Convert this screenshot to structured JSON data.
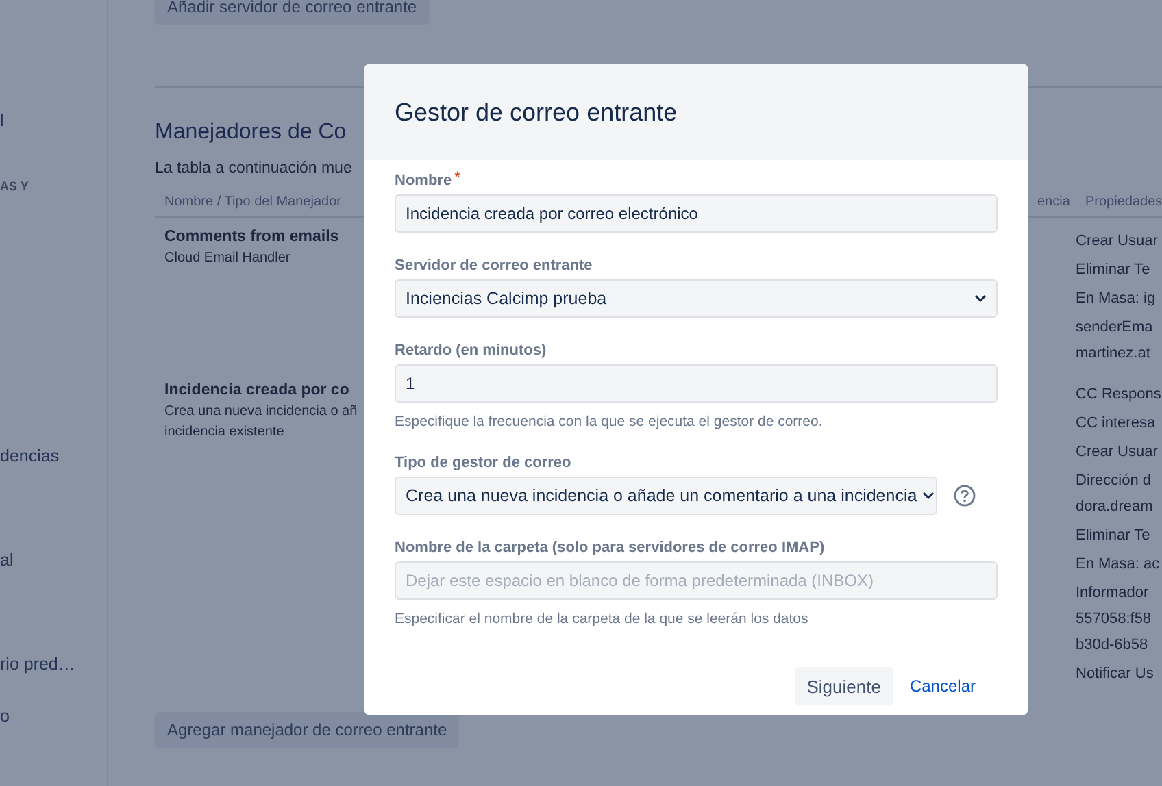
{
  "sidebar": {
    "items": [
      {
        "kind": "link",
        "label": "l"
      },
      {
        "kind": "heading",
        "label": "AS Y"
      },
      {
        "kind": "link",
        "label": "dencias"
      },
      {
        "kind": "link",
        "label": "al"
      },
      {
        "kind": "link",
        "label": "rio pred…"
      },
      {
        "kind": "link",
        "label": "o"
      }
    ]
  },
  "top_button": "Añadir servidor de correo entrante",
  "section": {
    "title": "Manejadores de Co",
    "description": "La tabla a continuación mue"
  },
  "table": {
    "columns": [
      "Nombre / Tipo del Manejador",
      "encia",
      "Propiedades"
    ],
    "rows": [
      {
        "name": "Comments from emails",
        "type": [
          "Cloud Email Handler"
        ],
        "properties": [
          [
            "Crear Usuar"
          ],
          [
            "Eliminar Te"
          ],
          [
            "En Masa: ig"
          ],
          [
            "senderEma",
            "martinez.at"
          ]
        ]
      },
      {
        "name": "Incidencia creada por co",
        "type": [
          "Crea una nueva incidencia o añ",
          "incidencia existente"
        ],
        "properties": [
          [
            "CC Respons"
          ],
          [
            "CC interesa"
          ],
          [
            "Crear Usuar"
          ],
          [
            "Dirección d",
            "dora.dream"
          ],
          [
            "Eliminar Te"
          ],
          [
            "En Masa: ac"
          ],
          [
            "Informador",
            "557058:f58",
            "b30d-6b58"
          ],
          [
            "Notificar Us"
          ]
        ]
      }
    ]
  },
  "add_button": "Agregar manejador de correo entrante",
  "dialog": {
    "title": "Gestor de correo entrante",
    "fields": [
      {
        "kind": "text",
        "label": "Nombre",
        "required_mark": "*",
        "value": "Incidencia creada por correo electrónico",
        "help_icon": false
      },
      {
        "kind": "select",
        "label": "Servidor de correo entrante",
        "value": "Inciencias Calcimp prueba",
        "help_icon": false
      },
      {
        "kind": "text",
        "label": "Retardo (en minutos)",
        "value": "1",
        "help": "Especifique la frecuencia con la que se ejecuta el gestor de correo.",
        "help_icon": false
      },
      {
        "kind": "select",
        "label": "Tipo de gestor de correo",
        "value": "Crea una nueva incidencia o añade un comentario a una incidencia",
        "help_icon": true
      },
      {
        "kind": "text",
        "label": "Nombre de la carpeta (solo para servidores de correo IMAP)",
        "placeholder": "Dejar este espacio en blanco de forma predeterminada (INBOX)",
        "help": "Especificar el nombre de la carpeta de la que se leerán los datos",
        "help_icon": false
      }
    ],
    "buttons": [
      {
        "kind": "primary",
        "label": "Siguiente"
      },
      {
        "kind": "link",
        "label": "Cancelar"
      }
    ]
  }
}
